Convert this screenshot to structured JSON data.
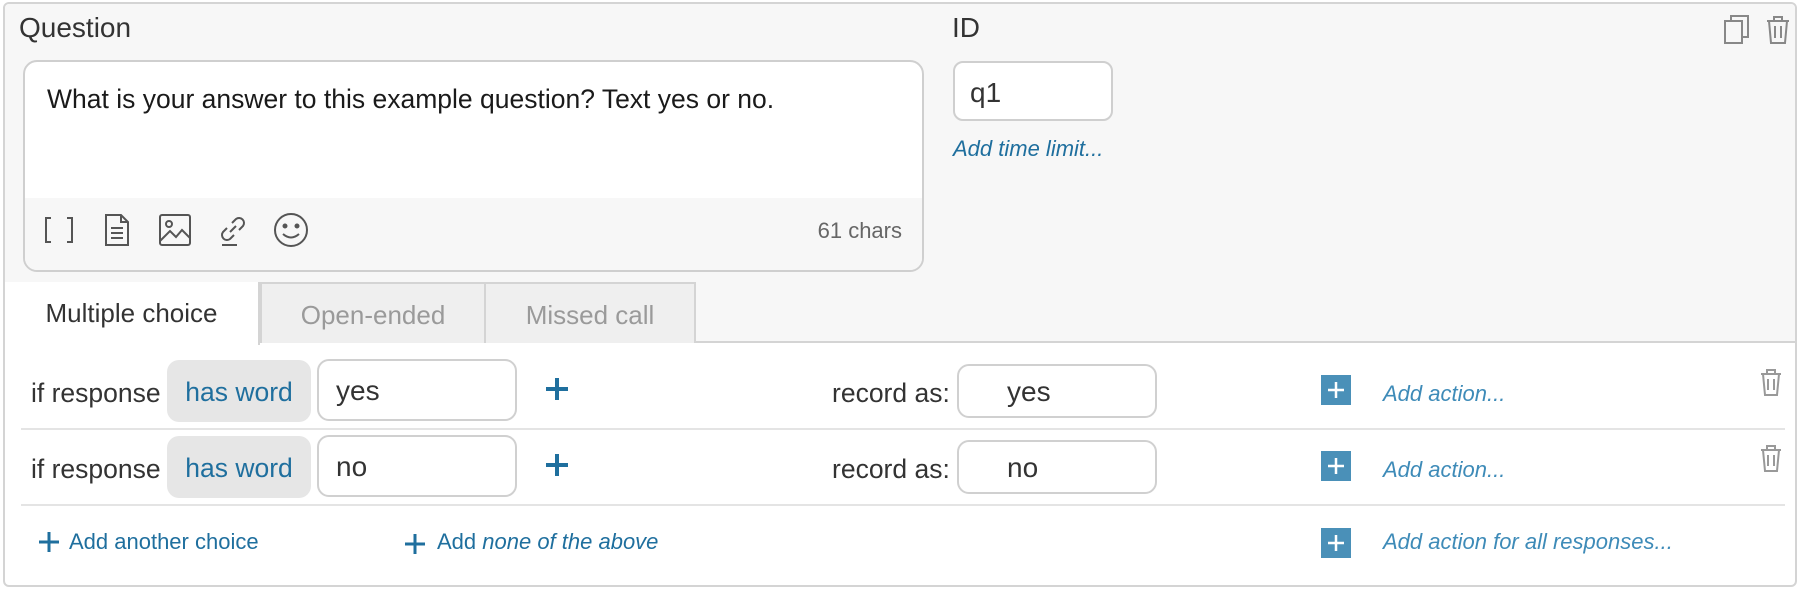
{
  "question": {
    "label": "Question",
    "text": "What is your answer to this example question? Text yes or no.",
    "char_count": "61 chars",
    "toolbar_icons": [
      "brackets-icon",
      "document-icon",
      "image-icon",
      "link-icon",
      "emoji-icon"
    ]
  },
  "id_field": {
    "label": "ID",
    "value": "q1",
    "time_limit_link": "Add time limit..."
  },
  "header_icons": [
    "copy-icon",
    "trash-icon"
  ],
  "tabs": [
    {
      "label": "Multiple choice",
      "active": true
    },
    {
      "label": "Open-ended",
      "active": false
    },
    {
      "label": "Missed call",
      "active": false
    }
  ],
  "choices": [
    {
      "prefix": "if response",
      "condition": "has word",
      "word": "yes",
      "record_label": "record as:",
      "record_value": "yes",
      "action_link": "Add action..."
    },
    {
      "prefix": "if response",
      "condition": "has word",
      "word": "no",
      "record_label": "record as:",
      "record_value": "no",
      "action_link": "Add action..."
    }
  ],
  "footer": {
    "add_choice": "Add another choice",
    "add_none_prefix": "Add ",
    "add_none_italic": "none of the above",
    "add_action_all": "Add action for all responses..."
  },
  "colors": {
    "accent": "#1f6f9e",
    "action_square": "#4a90b8",
    "panel_bg": "#f7f7f7",
    "condition_bg": "#e6e6e6"
  }
}
